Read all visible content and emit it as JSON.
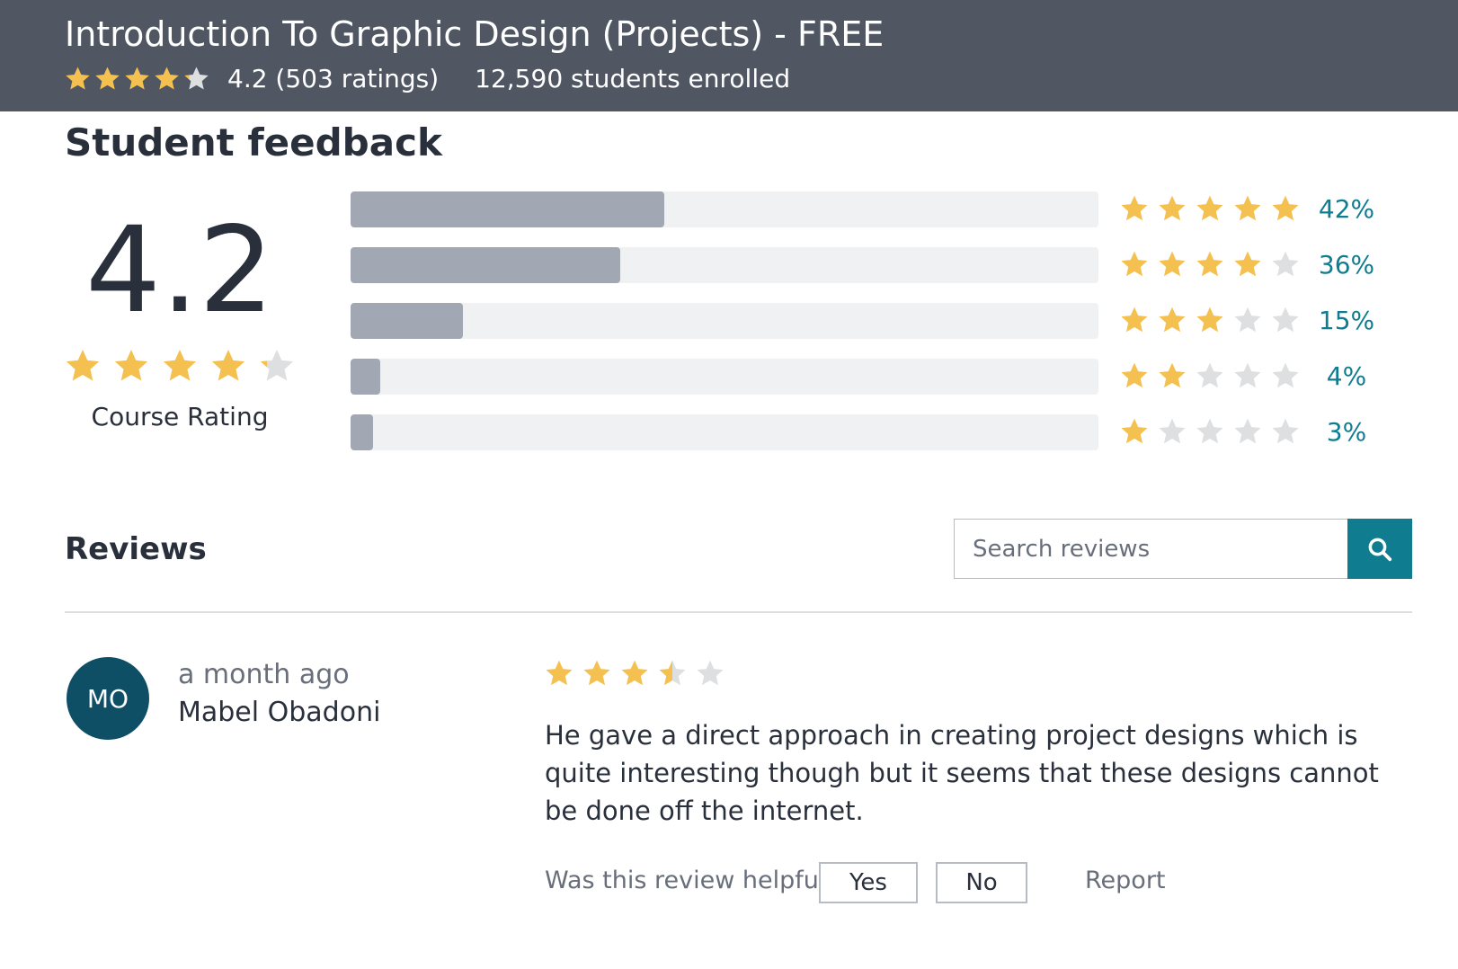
{
  "header": {
    "title": "Introduction To Graphic Design (Projects) - FREE",
    "rating_text": "4.2 (503 ratings)",
    "enrolled_text": "12,590 students enrolled",
    "stars_fill": [
      1,
      1,
      1,
      1,
      0.2
    ]
  },
  "feedback": {
    "section_title": "Student feedback",
    "average_rating": "4.2",
    "stars_fill": [
      1,
      1,
      1,
      1,
      0.2
    ],
    "rating_label": "Course Rating",
    "distribution": [
      {
        "stars": 5,
        "percent": 42,
        "label": "42%"
      },
      {
        "stars": 4,
        "percent": 36,
        "label": "36%"
      },
      {
        "stars": 3,
        "percent": 15,
        "label": "15%"
      },
      {
        "stars": 2,
        "percent": 4,
        "label": "4%"
      },
      {
        "stars": 1,
        "percent": 3,
        "label": "3%"
      }
    ]
  },
  "reviews": {
    "title": "Reviews",
    "search_placeholder": "Search reviews",
    "items": [
      {
        "initials": "MO",
        "time": "a month ago",
        "author": "Mabel Obadoni",
        "rating": 3.5,
        "text": "He gave a direct approach in creating project designs which is quite interesting though but it seems that these designs cannot be done off the internet.",
        "helpful_label": "Was this review helpful?",
        "yes_label": "Yes",
        "no_label": "No",
        "report_label": "Report"
      }
    ]
  },
  "colors": {
    "header_bg": "#505763",
    "star_filled": "#f4c150",
    "star_empty": "#dedfe0",
    "accent": "#0f7c90",
    "bar_fill": "#a1a7b3",
    "bar_track": "#f0f1f3",
    "avatar_bg": "#0f4f66"
  },
  "icons": {
    "star": "star-icon",
    "search": "search-icon"
  }
}
